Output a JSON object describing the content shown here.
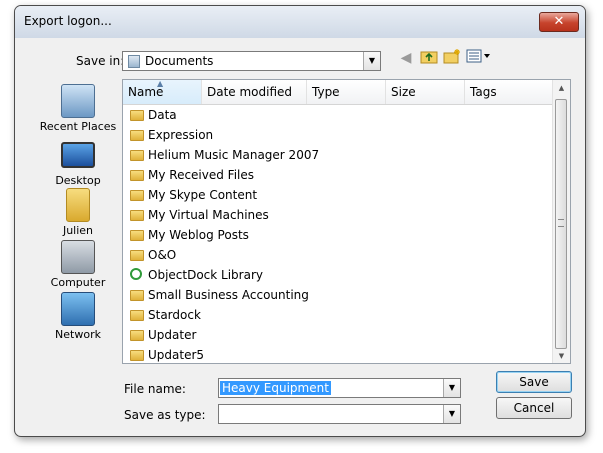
{
  "window": {
    "title": "Export logon...",
    "close_symbol": "✕"
  },
  "toolbar": {
    "save_in_label": "Save in:",
    "save_in_value": "Documents"
  },
  "places": [
    {
      "label": "Recent Places",
      "icon": "recent-places-icon"
    },
    {
      "label": "Desktop",
      "icon": "desktop-icon"
    },
    {
      "label": "Julien",
      "icon": "user-folder-icon"
    },
    {
      "label": "Computer",
      "icon": "computer-icon"
    },
    {
      "label": "Network",
      "icon": "network-icon"
    }
  ],
  "columns": [
    "Name",
    "Date modified",
    "Type",
    "Size",
    "Tags"
  ],
  "files": [
    {
      "name": "Data",
      "icon": "folder-icon"
    },
    {
      "name": "Expression",
      "icon": "folder-icon"
    },
    {
      "name": "Helium Music Manager 2007",
      "icon": "folder-icon"
    },
    {
      "name": "My Received Files",
      "icon": "folder-icon"
    },
    {
      "name": "My Skype Content",
      "icon": "folder-icon"
    },
    {
      "name": "My Virtual Machines",
      "icon": "folder-icon"
    },
    {
      "name": "My Weblog Posts",
      "icon": "folder-icon"
    },
    {
      "name": "O&O",
      "icon": "folder-icon"
    },
    {
      "name": "ObjectDock Library",
      "icon": "objectdock-icon"
    },
    {
      "name": "Small Business Accounting",
      "icon": "folder-icon"
    },
    {
      "name": "Stardock",
      "icon": "folder-icon"
    },
    {
      "name": "Updater",
      "icon": "folder-icon"
    },
    {
      "name": "Updater5",
      "icon": "folder-icon"
    }
  ],
  "form": {
    "file_name_label": "File name:",
    "file_name_value": "Heavy Equipment",
    "save_as_type_label": "Save as type:",
    "save_as_type_value": ""
  },
  "buttons": {
    "save": "Save",
    "cancel": "Cancel"
  }
}
